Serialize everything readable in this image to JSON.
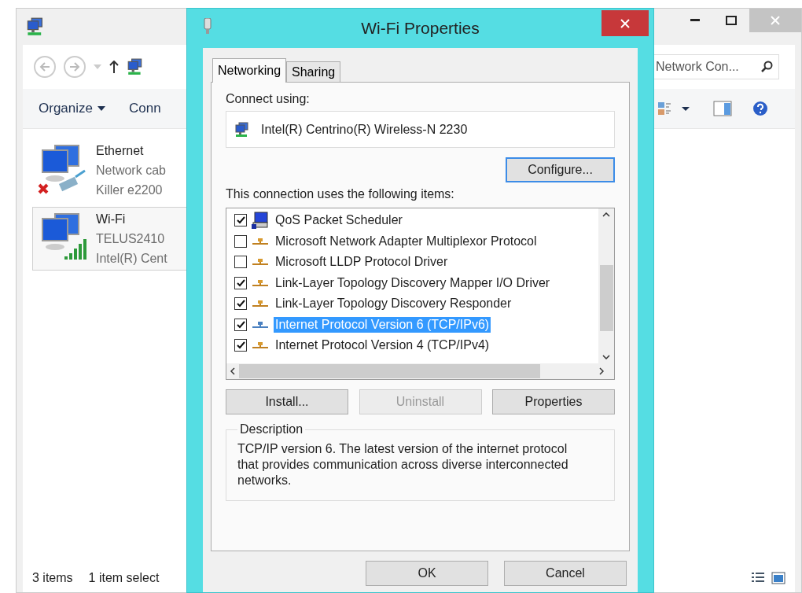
{
  "explorer": {
    "search": {
      "placeholder": "Network Con..."
    },
    "toolbar": [
      "Organize",
      "Conn"
    ],
    "items": [
      {
        "name": "Ethernet",
        "status": "Network cab",
        "device": "Killer e2200",
        "kind": "ethernet",
        "selected": false
      },
      {
        "name": "Wi-Fi",
        "status": "TELUS2410",
        "device": "Intel(R) Cent",
        "kind": "wifi",
        "selected": true
      }
    ],
    "status_bar": [
      "3 items",
      "1 item select"
    ]
  },
  "dialog": {
    "title": "Wi-Fi Properties",
    "tabs": [
      {
        "label": "Networking",
        "selected": true
      },
      {
        "label": "Sharing",
        "selected": false
      }
    ],
    "connect_label": "Connect using:",
    "adapter": "Intel(R) Centrino(R) Wireless-N 2230",
    "configure": "Configure...",
    "items_label": "This connection uses the following items:",
    "items": [
      {
        "label": "QoS Packet Scheduler",
        "kind": "scheduler",
        "checked": true,
        "selected": false
      },
      {
        "label": "Microsoft Network Adapter Multiplexor Protocol",
        "kind": "protocol",
        "checked": false,
        "selected": false
      },
      {
        "label": "Microsoft LLDP Protocol Driver",
        "kind": "protocol",
        "checked": false,
        "selected": false
      },
      {
        "label": "Link-Layer Topology Discovery Mapper I/O Driver",
        "kind": "protocol",
        "checked": true,
        "selected": false
      },
      {
        "label": "Link-Layer Topology Discovery Responder",
        "kind": "protocol",
        "checked": true,
        "selected": false
      },
      {
        "label": "Internet Protocol Version 6 (TCP/IPv6)",
        "kind": "protocol",
        "checked": true,
        "selected": true
      },
      {
        "label": "Internet Protocol Version 4 (TCP/IPv4)",
        "kind": "protocol",
        "checked": true,
        "selected": false
      }
    ],
    "actions": [
      {
        "label": "Install...",
        "disabled": false
      },
      {
        "label": "Uninstall",
        "disabled": true
      },
      {
        "label": "Properties",
        "disabled": false
      }
    ],
    "description": {
      "legend": "Description",
      "text": "TCP/IP version 6. The latest version of the internet protocol that provides communication across diverse interconnected networks."
    },
    "buttons": [
      "OK",
      "Cancel"
    ]
  }
}
